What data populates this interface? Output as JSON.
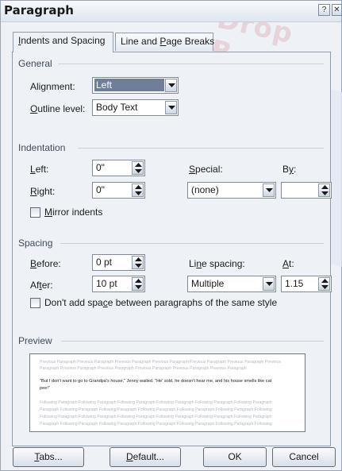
{
  "window": {
    "title": "Paragraph",
    "help_glyph": "?",
    "close_glyph": "✕",
    "watermark_text": "Drop B"
  },
  "tabs": [
    {
      "label": "Indents and Spacing",
      "mnemonic": "I",
      "rest": "ndents and Spacing",
      "active": true
    },
    {
      "label": "Line and Page Breaks",
      "pre": "Line and ",
      "mnemonic": "P",
      "rest": "age Breaks",
      "active": false
    }
  ],
  "general": {
    "heading": "General",
    "alignment_label": {
      "pre": "Ali",
      "mnemonic": "g",
      "rest": "nment:"
    },
    "alignment_value": "Left",
    "outline_label": {
      "pre": "",
      "mnemonic": "O",
      "rest": "utline level:"
    },
    "outline_value": "Body Text"
  },
  "indentation": {
    "heading": "Indentation",
    "left_label": {
      "pre": "",
      "mnemonic": "L",
      "rest": "eft:"
    },
    "left_value": "0\"",
    "right_label": {
      "pre": "",
      "mnemonic": "R",
      "rest": "ight:"
    },
    "right_value": "0\"",
    "special_label": {
      "pre": "",
      "mnemonic": "S",
      "rest": "pecial:"
    },
    "special_value": "(none)",
    "by_label": {
      "pre": "B",
      "mnemonic": "y",
      "rest": ":"
    },
    "by_value": "",
    "mirror_label": {
      "pre": "",
      "mnemonic": "M",
      "rest": "irror indents"
    },
    "mirror_checked": false
  },
  "spacing": {
    "heading": "Spacing",
    "before_label": {
      "pre": "",
      "mnemonic": "B",
      "rest": "efore:"
    },
    "before_value": "0 pt",
    "after_label": {
      "pre": "Af",
      "mnemonic": "t",
      "rest": "er:"
    },
    "after_value": "10 pt",
    "line_spacing_label": {
      "pre": "Li",
      "mnemonic": "n",
      "rest": "e spacing:"
    },
    "line_spacing_value": "Multiple",
    "at_label": {
      "pre": "",
      "mnemonic": "A",
      "rest": "t:"
    },
    "at_value": "1.15",
    "dont_add_label": {
      "pre": "Don't add spa",
      "mnemonic": "c",
      "rest": "e between paragraphs of the same style"
    },
    "dont_add_checked": false
  },
  "preview": {
    "heading": "Preview",
    "previous_lines": [
      "Previous Paragraph Previous Paragraph Previous Paragraph Previous Paragraph Previous Paragraph Previous Paragraph Previous",
      "Paragraph Previous Paragraph Previous Paragraph Previous Paragraph Previous Paragraph Previous Paragraph"
    ],
    "current_lines": [
      "\"But I don't want to go to Grandpa's house,\" Jenny wailed. \"He' sold, he doesn't hear me, and his house smells like cat",
      "pee!\""
    ],
    "following_lines": [
      "Following Paragraph Following Paragraph Following Paragraph Following Paragraph Following Paragraph Following Paragraph",
      "Paragraph Following Paragraph Following Paragraph Following Paragraph Following Paragraph Following Paragraph Following",
      "Following Paragraph Following Paragraph Following Paragraph Following Paragraph Following Paragraph Following Paragraph",
      "Paragraph Following Paragraph Following Paragraph Following Paragraph Following Paragraph Following Paragraph Following"
    ]
  },
  "buttons": {
    "tabs": {
      "pre": "",
      "mnemonic": "T",
      "rest": "abs..."
    },
    "default": {
      "pre": "",
      "mnemonic": "D",
      "rest": "efault..."
    },
    "ok": "OK",
    "cancel": "Cancel"
  },
  "colors": {
    "dialog_bg": "#eef2f7",
    "selection": "#6f7f99",
    "watermark": "#e4c3cd"
  }
}
